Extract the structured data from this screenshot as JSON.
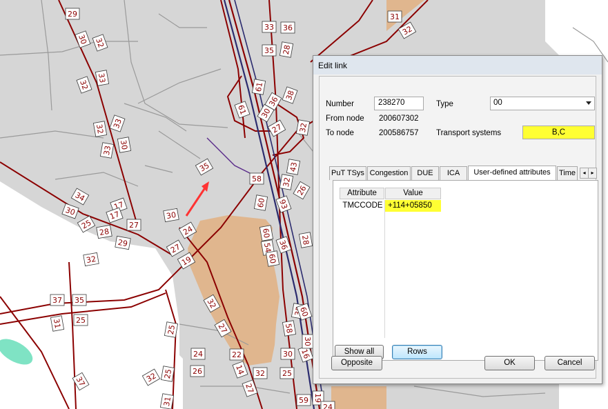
{
  "map": {
    "colors": {
      "background": "#d6d6d6",
      "white_area": "#ffffff",
      "sand_area": "#e0b68e",
      "water": "#7fe3c4",
      "road": "#8b0000",
      "minor_road": "#9a9a9a",
      "highway_blue": "#2b2b6e",
      "active_link": "#ff3333"
    },
    "labels": [
      "29",
      "30",
      "32",
      "33",
      "32",
      "33",
      "32",
      "33",
      "30",
      "35",
      "34",
      "30",
      "17",
      "25",
      "17",
      "28",
      "27",
      "29",
      "32",
      "30",
      "24",
      "27",
      "19",
      "37",
      "35",
      "31",
      "25",
      "32",
      "27",
      "25",
      "24",
      "26",
      "32",
      "25",
      "22",
      "30",
      "25",
      "14",
      "32",
      "27",
      "31",
      "37",
      "31",
      "32",
      "33",
      "35",
      "36",
      "28",
      "61",
      "30",
      "36",
      "27",
      "61",
      "38",
      "32",
      "58",
      "60",
      "32",
      "43",
      "26",
      "93",
      "60",
      "54",
      "60",
      "36",
      "28",
      "35",
      "60",
      "58",
      "16",
      "30",
      "59",
      "19",
      "24"
    ]
  },
  "dialog": {
    "title": "Edit link",
    "number_label": "Number",
    "number_value": "238270",
    "type_label": "Type",
    "type_value": "00",
    "from_node_label": "From node",
    "from_node_value": "200607302",
    "to_node_label": "To node",
    "to_node_value": "200586757",
    "transport_label": "Transport systems",
    "transport_value": "B,C",
    "tabs": [
      "PuT TSys",
      "Congestion",
      "DUE",
      "ICA",
      "User-defined attributes",
      "Time"
    ],
    "active_tab": "User-defined attributes",
    "table": {
      "headers": [
        "Attribute",
        "Value"
      ],
      "rows": [
        {
          "attribute": "TMCCODE",
          "value": "+114+05850"
        }
      ]
    },
    "show_all_button": "Show all",
    "rows_button": "Rows",
    "opposite_button": "Opposite",
    "ok_button": "OK",
    "cancel_button": "Cancel",
    "highlight_color": "#ffff33"
  }
}
